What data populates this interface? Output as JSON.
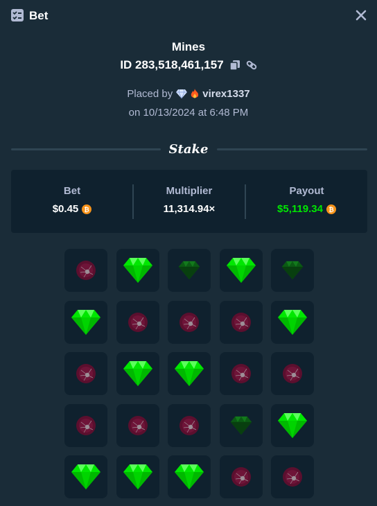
{
  "header": {
    "title": "Bet",
    "bet_icon": "bet-list-icon",
    "close_icon": "close-icon"
  },
  "game": {
    "name": "Mines",
    "id_text": "ID 283,518,461,157"
  },
  "placed": {
    "prefix": "Placed by",
    "username": "virex1337",
    "badges": [
      "diamond-vip-icon",
      "fire-icon"
    ],
    "date_text": "on 10/13/2024 at 6:48 PM"
  },
  "brand": {
    "logo_text": "Stake"
  },
  "stats": [
    {
      "label": "Bet",
      "value": "$0.45",
      "currency_icon": "bitcoin-icon"
    },
    {
      "label": "Multiplier",
      "value": "11,314.94×"
    },
    {
      "label": "Payout",
      "value": "$5,119.34",
      "currency_icon": "bitcoin-icon"
    }
  ],
  "colors": {
    "background": "#1a2c38",
    "panel": "#0f212e",
    "payout_green": "#00e701",
    "gem_green": "#00d600",
    "bitcoin": "#f7931a",
    "muted_text": "#b1bad3"
  },
  "board": {
    "tiles": [
      [
        "mine",
        "gem",
        "gem-dim",
        "gem",
        "gem-dim"
      ],
      [
        "gem",
        "mine",
        "mine",
        "mine",
        "gem"
      ],
      [
        "mine",
        "gem",
        "gem",
        "mine",
        "mine"
      ],
      [
        "mine",
        "mine",
        "mine",
        "gem-dim",
        "gem"
      ],
      [
        "gem",
        "gem",
        "gem",
        "mine",
        "mine"
      ]
    ]
  }
}
